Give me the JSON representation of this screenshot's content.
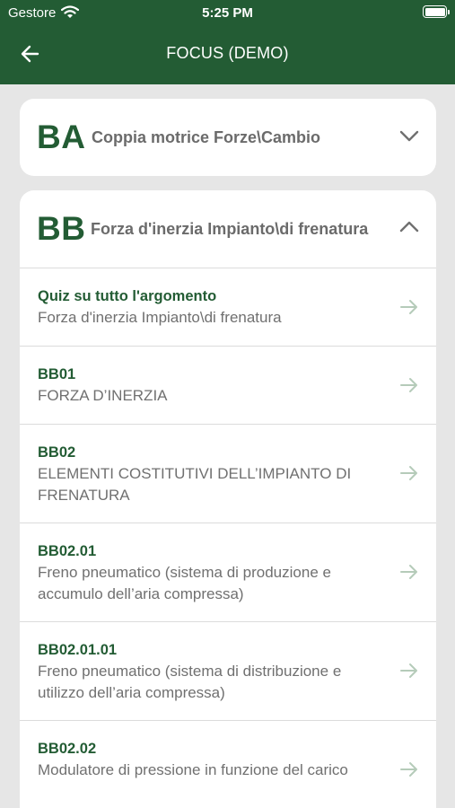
{
  "status_bar": {
    "carrier": "Gestore",
    "time": "5:25 PM"
  },
  "header": {
    "title": "FOCUS (DEMO)"
  },
  "sections": [
    {
      "code": "BA",
      "title": "Coppia motrice Forze\\Cambio",
      "expanded": false
    },
    {
      "code": "BB",
      "title": "Forza d'inerzia Impianto\\di frenatura",
      "expanded": true,
      "items": [
        {
          "title": "Quiz su tutto l'argomento",
          "subtitle": "Forza d'inerzia Impianto\\di frenatura"
        },
        {
          "title": "BB01",
          "subtitle": "FORZA D’INERZIA"
        },
        {
          "title": "BB02",
          "subtitle": "ELEMENTI COSTITUTIVI DELL’IMPIANTO DI FRENATURA"
        },
        {
          "title": "BB02.01",
          "subtitle": "Freno pneumatico (sistema di produzione e accumulo dell’aria compressa)"
        },
        {
          "title": "BB02.01.01",
          "subtitle": "Freno pneumatico (sistema di distribuzione e utilizzo dell’aria compressa)"
        },
        {
          "title": "BB02.02",
          "subtitle": "Modulatore di pressione in funzione del carico"
        }
      ]
    }
  ],
  "colors": {
    "primary": "#235c34",
    "background": "#e6e6e6",
    "arrow": "#b5cbb9"
  },
  "icons": {
    "back": "arrow-left-icon",
    "collapsed": "chevron-down-icon",
    "expanded": "chevron-up-icon",
    "row": "arrow-right-icon"
  }
}
